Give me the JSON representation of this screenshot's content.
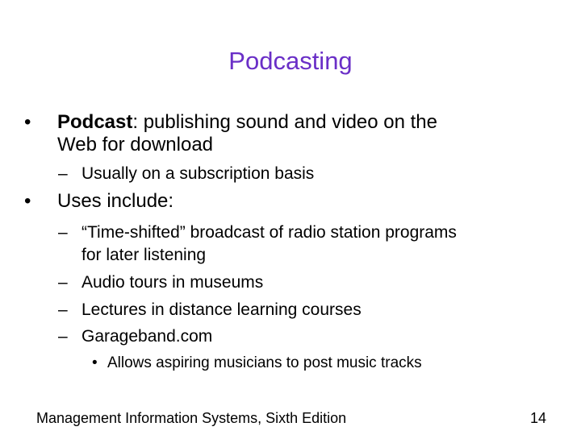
{
  "title": "Podcasting",
  "bullets": {
    "podcast_term": "Podcast",
    "podcast_def_line1": ": publishing sound and video on the",
    "podcast_def_line2": "Web for download",
    "subscription": "Usually on a subscription basis",
    "uses": "Uses include:",
    "time_shifted_line1": "“Time-shifted” broadcast of radio station programs",
    "time_shifted_line2": "for later listening",
    "audio_tours": "Audio tours in museums",
    "lectures": "Lectures in distance learning courses",
    "garageband": "Garageband.com",
    "musicians": "Allows aspiring musicians to post music tracks"
  },
  "markers": {
    "level1": "•",
    "level2": "–",
    "level3": "•"
  },
  "footer": {
    "book": "Management Information Systems, Sixth Edition",
    "page_number": "14"
  },
  "colors": {
    "title": "#6a2fc7",
    "text": "#000000",
    "background": "#ffffff"
  }
}
